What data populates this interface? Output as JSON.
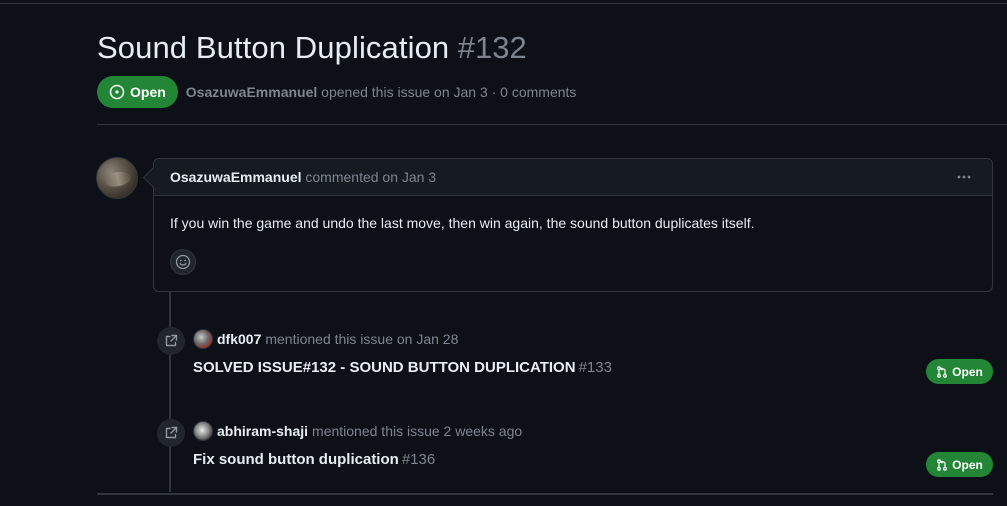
{
  "issue": {
    "title": "Sound Button Duplication",
    "number": "#132",
    "state_label": "Open",
    "author": "OsazuwaEmmanuel",
    "opened_text": "opened this issue on Jan 3 · 0 comments"
  },
  "comment": {
    "author": "OsazuwaEmmanuel",
    "meta": "commented on Jan 3",
    "body": "If you win the game and undo the last move, then win again, the sound button duplicates itself.",
    "menu_icon": "kebab-horizontal-icon",
    "reaction_icon": "smiley-icon"
  },
  "timeline": [
    {
      "user": "dfk007",
      "action": "mentioned this issue on Jan 28",
      "pr_title": "SOLVED ISSUE#132 - SOUND BUTTON DUPLICATION",
      "pr_number": "#133",
      "state_label": "Open"
    },
    {
      "user": "abhiram-shaji",
      "action": "mentioned this issue 2 weeks ago",
      "pr_title": "Fix sound button duplication",
      "pr_number": "#136",
      "state_label": "Open"
    }
  ],
  "colors": {
    "background": "#0d1117",
    "open_green": "#238636",
    "muted_text": "#7d8590",
    "border": "#30363d"
  }
}
